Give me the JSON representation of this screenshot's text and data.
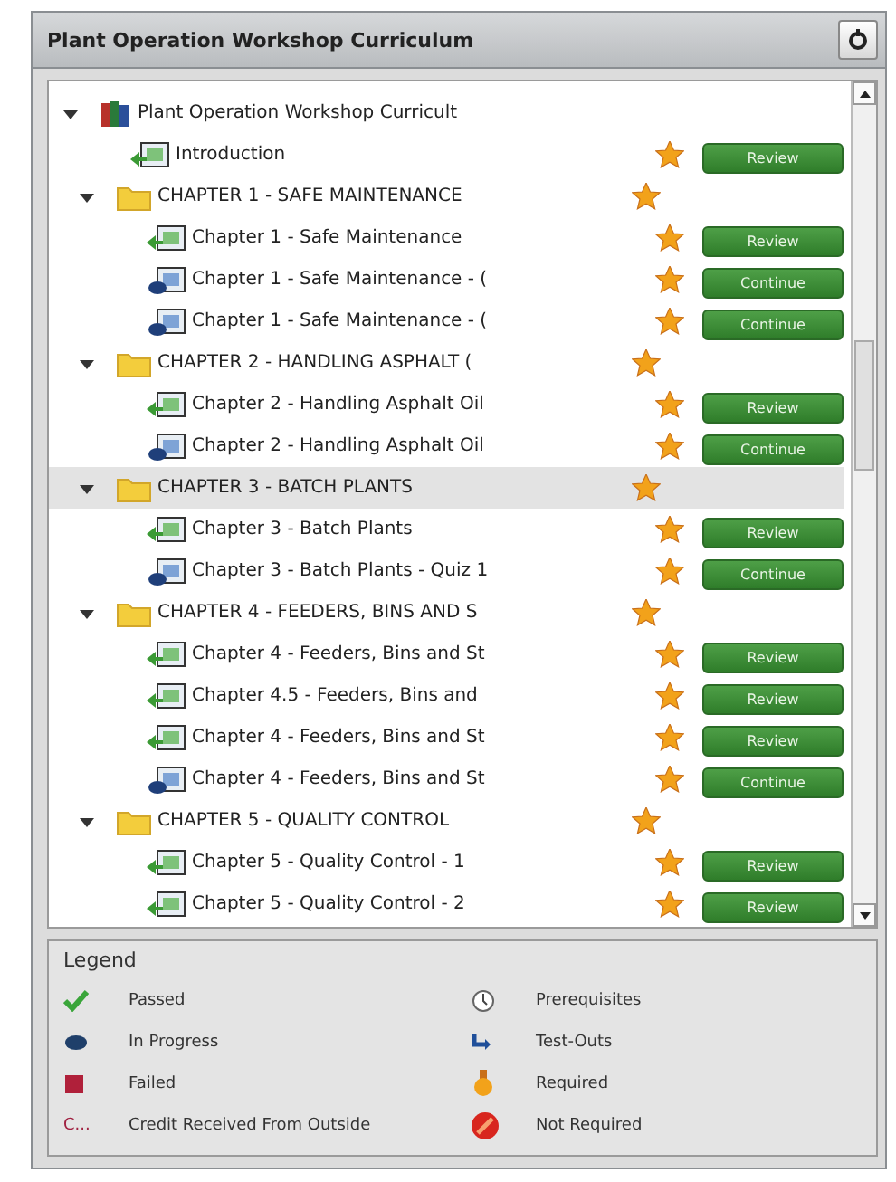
{
  "panel": {
    "title": "Plant Operation Workshop Curriculum"
  },
  "tree": [
    {
      "kind": "course",
      "label": "Plant Operation Workshop Curricult",
      "expanded": true,
      "selected": false,
      "children": [
        {
          "kind": "module",
          "label": "Introduction",
          "passed": true,
          "required": true,
          "action": "Review",
          "selected": false
        },
        {
          "kind": "folder",
          "label": "CHAPTER 1 - SAFE MAINTENANCE",
          "expanded": true,
          "required": true,
          "selected": false,
          "children": [
            {
              "kind": "module",
              "label": "Chapter 1 - Safe Maintenance",
              "passed": true,
              "required": true,
              "action": "Review",
              "selected": false
            },
            {
              "kind": "module",
              "label": "Chapter 1 - Safe Maintenance - (",
              "passed": false,
              "required": true,
              "action": "Continue",
              "selected": false
            },
            {
              "kind": "module",
              "label": "Chapter 1 - Safe Maintenance - (",
              "passed": false,
              "required": true,
              "action": "Continue",
              "selected": false
            }
          ]
        },
        {
          "kind": "folder",
          "label": "CHAPTER 2 - HANDLING ASPHALT (",
          "expanded": true,
          "required": true,
          "selected": false,
          "children": [
            {
              "kind": "module",
              "label": "Chapter 2 - Handling Asphalt Oil",
              "passed": true,
              "required": true,
              "action": "Review",
              "selected": false
            },
            {
              "kind": "module",
              "label": "Chapter 2 - Handling Asphalt Oil",
              "passed": false,
              "required": true,
              "action": "Continue",
              "selected": false
            }
          ]
        },
        {
          "kind": "folder",
          "label": "CHAPTER 3 - BATCH PLANTS",
          "expanded": true,
          "required": true,
          "selected": true,
          "children": [
            {
              "kind": "module",
              "label": "Chapter 3 - Batch Plants",
              "passed": true,
              "required": true,
              "action": "Review",
              "selected": false
            },
            {
              "kind": "module",
              "label": "Chapter 3 - Batch Plants - Quiz 1",
              "passed": false,
              "required": true,
              "action": "Continue",
              "selected": false
            }
          ]
        },
        {
          "kind": "folder",
          "label": "CHAPTER 4 - FEEDERS, BINS AND S",
          "expanded": true,
          "required": true,
          "selected": false,
          "children": [
            {
              "kind": "module",
              "label": "Chapter 4 - Feeders, Bins and St",
              "passed": true,
              "required": true,
              "action": "Review",
              "selected": false
            },
            {
              "kind": "module",
              "label": "Chapter 4.5 - Feeders, Bins and",
              "passed": true,
              "required": true,
              "action": "Review",
              "selected": false
            },
            {
              "kind": "module",
              "label": "Chapter 4 - Feeders, Bins and St",
              "passed": true,
              "required": true,
              "action": "Review",
              "selected": false
            },
            {
              "kind": "module",
              "label": "Chapter 4 - Feeders, Bins and St",
              "passed": false,
              "required": true,
              "action": "Continue",
              "selected": false
            }
          ]
        },
        {
          "kind": "folder",
          "label": "CHAPTER 5 - QUALITY CONTROL",
          "expanded": true,
          "required": true,
          "selected": false,
          "children": [
            {
              "kind": "module",
              "label": "Chapter 5 - Quality Control - 1",
              "passed": true,
              "required": true,
              "action": "Review",
              "selected": false
            },
            {
              "kind": "module",
              "label": "Chapter 5 - Quality Control - 2",
              "passed": true,
              "required": true,
              "action": "Review",
              "selected": false
            }
          ]
        }
      ]
    }
  ],
  "legend": {
    "title": "Legend",
    "items": [
      {
        "kind": "passed",
        "label": "Passed"
      },
      {
        "kind": "in_progress",
        "label": "In Progress"
      },
      {
        "kind": "failed",
        "label": "Failed"
      },
      {
        "kind": "credit",
        "icon_text": "C...",
        "label": "Credit Received From Outside"
      },
      {
        "kind": "prerequisites",
        "label": "Prerequisites"
      },
      {
        "kind": "test_outs",
        "label": "Test-Outs"
      },
      {
        "kind": "required",
        "label": "Required"
      },
      {
        "kind": "not_required",
        "label": "Not Required"
      }
    ]
  }
}
